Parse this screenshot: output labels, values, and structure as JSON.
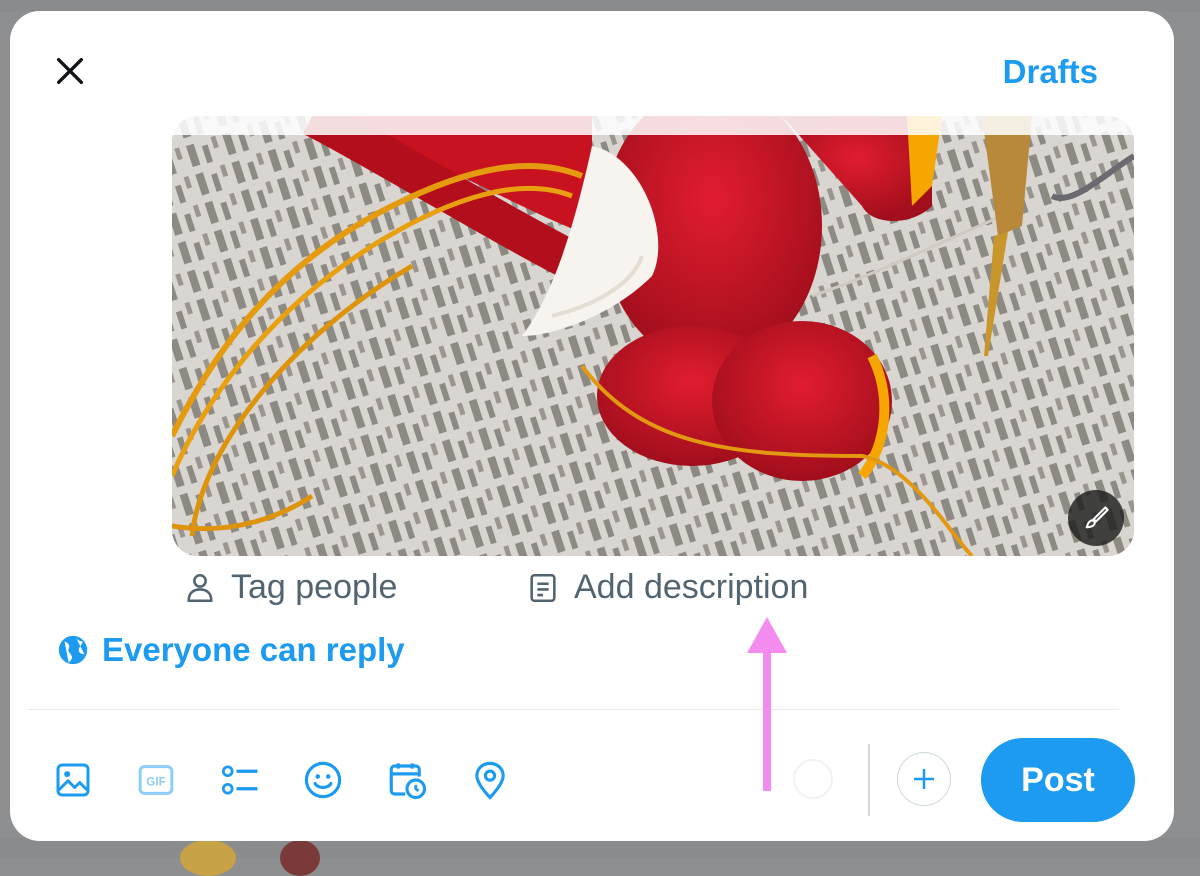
{
  "header": {
    "close_icon": "close-icon",
    "drafts_label": "Drafts"
  },
  "media": {
    "edit_icon": "brush-icon"
  },
  "media_actions": {
    "tag_people": {
      "label": "Tag people",
      "icon": "person-icon"
    },
    "add_description": {
      "label": "Add description",
      "icon": "document-icon"
    }
  },
  "reply_settings": {
    "label": "Everyone can reply",
    "icon": "globe-icon"
  },
  "toolbar": {
    "tools": [
      "image-icon",
      "gif-icon",
      "poll-icon",
      "emoji-icon",
      "schedule-icon",
      "location-icon"
    ],
    "add_icon": "plus-icon",
    "post_label": "Post"
  },
  "colors": {
    "accent": "#1d9bf0",
    "secondary_text": "#536471",
    "annotation_arrow": "#f48cf0"
  }
}
